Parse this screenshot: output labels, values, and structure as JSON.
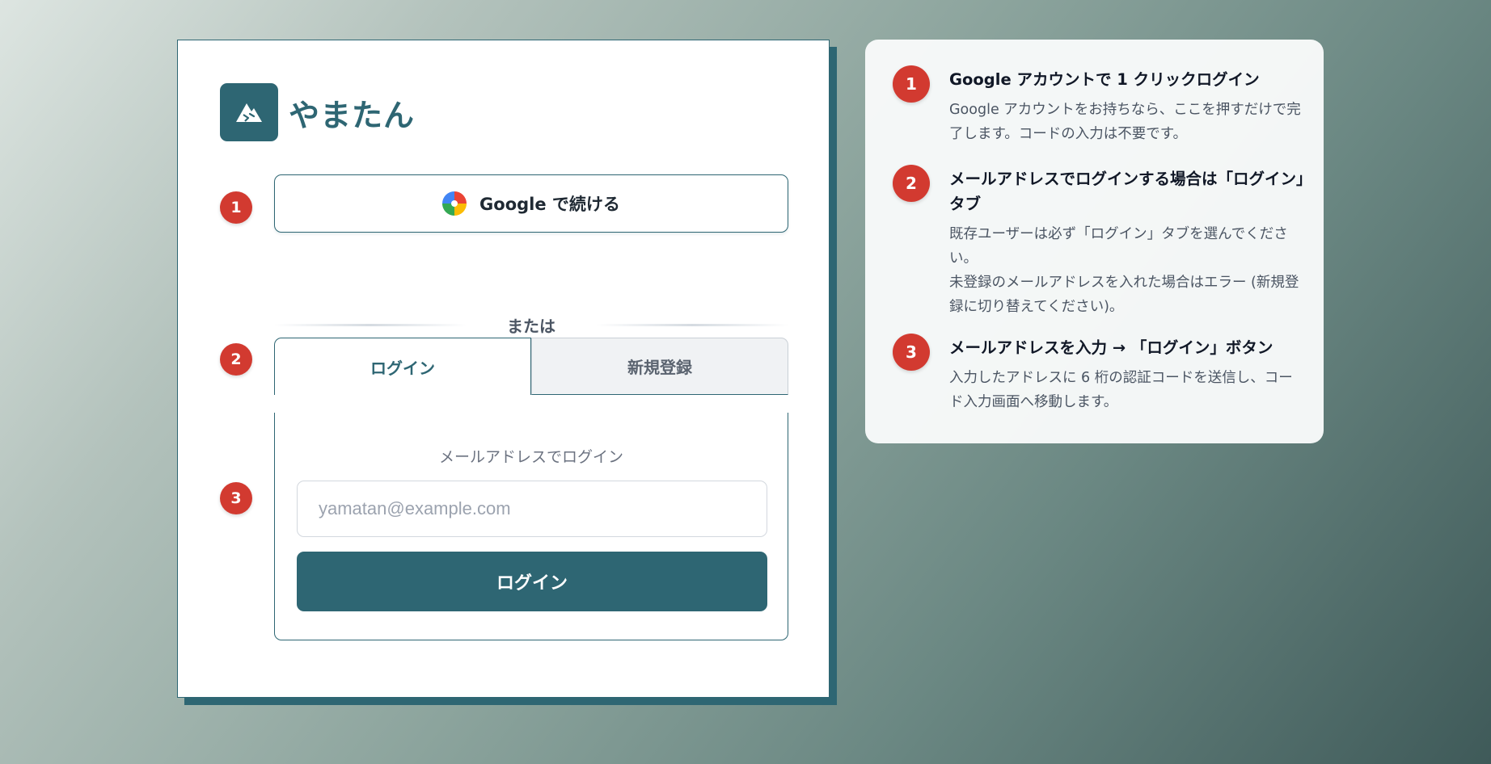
{
  "brand": {
    "name": "やまたん",
    "logo_icon": "mountain-icon"
  },
  "login_card": {
    "steps": [
      "1",
      "2",
      "3"
    ],
    "google_button": {
      "label": "Google で続ける",
      "icon": "google-icon"
    },
    "divider_text": "または",
    "tabs": [
      {
        "label": "ログイン",
        "active": true
      },
      {
        "label": "新規登録",
        "active": false
      }
    ],
    "form": {
      "hint": "メールアドレスでログイン",
      "email_placeholder": "yamatan@example.com",
      "email_value": "",
      "submit_label": "ログイン"
    }
  },
  "guide": {
    "items": [
      {
        "number": "1",
        "title": "Google アカウントで 1 クリックログイン",
        "body": [
          "Google アカウントをお持ちなら、ここを押すだけで完了します。コードの入力は不要です。"
        ]
      },
      {
        "number": "2",
        "title": "メールアドレスでログインする場合は「ログイン」タブ",
        "body": [
          "既存ユーザーは必ず「ログイン」タブを選んでください。",
          "未登録のメールアドレスを入れた場合はエラー (新規登録に切り替えてください)。"
        ]
      },
      {
        "number": "3",
        "title": "メールアドレスを入力 → 「ログイン」ボタン",
        "body": [
          "入力したアドレスに 6 桁の認証コードを送信し、コード入力画面へ移動します。"
        ]
      }
    ]
  },
  "colors": {
    "primary": "#2e6673",
    "step_badge": "#d23a30",
    "tab_inactive_bg": "#f0f2f4"
  }
}
